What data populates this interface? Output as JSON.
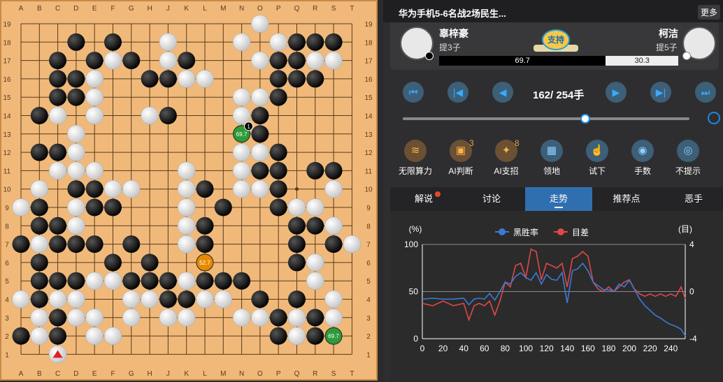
{
  "board": {
    "size": 19,
    "columns": [
      "A",
      "B",
      "C",
      "D",
      "E",
      "F",
      "G",
      "H",
      "J",
      "K",
      "L",
      "M",
      "N",
      "O",
      "P",
      "Q",
      "R",
      "S",
      "T"
    ],
    "rows": [
      "19",
      "18",
      "17",
      "16",
      "15",
      "14",
      "13",
      "12",
      "11",
      "10",
      "9",
      "8",
      "7",
      "6",
      "5",
      "4",
      "3",
      "2",
      "1"
    ],
    "black": [
      [
        3,
        18
      ],
      [
        5,
        18
      ],
      [
        15,
        18
      ],
      [
        16,
        18
      ],
      [
        17,
        18
      ],
      [
        2,
        17
      ],
      [
        4,
        17
      ],
      [
        6,
        17
      ],
      [
        9,
        17
      ],
      [
        14,
        17
      ],
      [
        15,
        17
      ],
      [
        2,
        16
      ],
      [
        3,
        16
      ],
      [
        7,
        16
      ],
      [
        8,
        16
      ],
      [
        14,
        16
      ],
      [
        15,
        16
      ],
      [
        16,
        16
      ],
      [
        2,
        15
      ],
      [
        3,
        15
      ],
      [
        14,
        15
      ],
      [
        1,
        14
      ],
      [
        8,
        14
      ],
      [
        13,
        14
      ],
      [
        13,
        13
      ],
      [
        1,
        12
      ],
      [
        2,
        12
      ],
      [
        14,
        12
      ],
      [
        13,
        11
      ],
      [
        14,
        11
      ],
      [
        16,
        11
      ],
      [
        17,
        11
      ],
      [
        3,
        10
      ],
      [
        4,
        10
      ],
      [
        10,
        10
      ],
      [
        14,
        10
      ],
      [
        1,
        9
      ],
      [
        4,
        9
      ],
      [
        5,
        9
      ],
      [
        11,
        9
      ],
      [
        14,
        9
      ],
      [
        1,
        8
      ],
      [
        2,
        8
      ],
      [
        10,
        8
      ],
      [
        15,
        8
      ],
      [
        16,
        8
      ],
      [
        0,
        7
      ],
      [
        2,
        7
      ],
      [
        3,
        7
      ],
      [
        4,
        7
      ],
      [
        6,
        7
      ],
      [
        10,
        7
      ],
      [
        15,
        7
      ],
      [
        17,
        7
      ],
      [
        1,
        6
      ],
      [
        5,
        6
      ],
      [
        7,
        6
      ],
      [
        15,
        6
      ],
      [
        16,
        6
      ],
      [
        1,
        5
      ],
      [
        2,
        5
      ],
      [
        3,
        5
      ],
      [
        6,
        5
      ],
      [
        7,
        5
      ],
      [
        8,
        5
      ],
      [
        10,
        5
      ],
      [
        11,
        5
      ],
      [
        12,
        5
      ],
      [
        1,
        4
      ],
      [
        8,
        4
      ],
      [
        9,
        4
      ],
      [
        13,
        4
      ],
      [
        15,
        4
      ],
      [
        2,
        3
      ],
      [
        14,
        3
      ],
      [
        16,
        3
      ],
      [
        0,
        2
      ],
      [
        2,
        2
      ],
      [
        14,
        2
      ],
      [
        16,
        2
      ]
    ],
    "white": [
      [
        13,
        19
      ],
      [
        8,
        18
      ],
      [
        12,
        18
      ],
      [
        14,
        18
      ],
      [
        5,
        17
      ],
      [
        8,
        17
      ],
      [
        13,
        17
      ],
      [
        16,
        17
      ],
      [
        17,
        17
      ],
      [
        4,
        16
      ],
      [
        9,
        16
      ],
      [
        10,
        16
      ],
      [
        4,
        15
      ],
      [
        12,
        15
      ],
      [
        13,
        15
      ],
      [
        2,
        14
      ],
      [
        4,
        14
      ],
      [
        7,
        14
      ],
      [
        12,
        14
      ],
      [
        3,
        13
      ],
      [
        3,
        12
      ],
      [
        12,
        12
      ],
      [
        13,
        12
      ],
      [
        2,
        11
      ],
      [
        3,
        11
      ],
      [
        4,
        11
      ],
      [
        9,
        11
      ],
      [
        12,
        11
      ],
      [
        1,
        10
      ],
      [
        5,
        10
      ],
      [
        6,
        10
      ],
      [
        9,
        10
      ],
      [
        12,
        10
      ],
      [
        13,
        10
      ],
      [
        17,
        10
      ],
      [
        0,
        9
      ],
      [
        3,
        9
      ],
      [
        9,
        9
      ],
      [
        15,
        9
      ],
      [
        16,
        9
      ],
      [
        3,
        8
      ],
      [
        9,
        8
      ],
      [
        17,
        8
      ],
      [
        1,
        7
      ],
      [
        9,
        7
      ],
      [
        18,
        7
      ],
      [
        16,
        6
      ],
      [
        4,
        5
      ],
      [
        5,
        5
      ],
      [
        9,
        5
      ],
      [
        16,
        5
      ],
      [
        0,
        4
      ],
      [
        2,
        4
      ],
      [
        3,
        4
      ],
      [
        6,
        4
      ],
      [
        7,
        4
      ],
      [
        10,
        4
      ],
      [
        11,
        4
      ],
      [
        17,
        4
      ],
      [
        1,
        3
      ],
      [
        3,
        3
      ],
      [
        4,
        3
      ],
      [
        6,
        3
      ],
      [
        8,
        3
      ],
      [
        9,
        3
      ],
      [
        12,
        3
      ],
      [
        13,
        3
      ],
      [
        15,
        3
      ],
      [
        17,
        3
      ],
      [
        1,
        2
      ],
      [
        4,
        2
      ],
      [
        5,
        2
      ],
      [
        15,
        2
      ]
    ],
    "hoshi": [
      [
        3,
        16
      ],
      [
        9,
        16
      ],
      [
        15,
        16
      ],
      [
        3,
        10
      ],
      [
        9,
        10
      ],
      [
        15,
        10
      ],
      [
        3,
        4
      ],
      [
        9,
        4
      ],
      [
        15,
        4
      ]
    ],
    "markers": [
      {
        "col": 12,
        "row": 13,
        "color": "#2e9a3a",
        "label": "69.7",
        "tag": "1"
      },
      {
        "col": 10,
        "row": 6,
        "color": "#e58a00",
        "label": "52.7",
        "tag": ""
      },
      {
        "col": 17,
        "row": 2,
        "color": "#2e9a3a",
        "label": "69.7",
        "tag": ""
      }
    ],
    "last_move": {
      "col": 2,
      "row": 1,
      "color": "#e02020"
    }
  },
  "header": {
    "title": "华为手机5-6名战2场民生...",
    "more_label": "更多"
  },
  "players": {
    "black_name": "辜梓豪",
    "black_captures": "提3子",
    "white_name": "柯洁",
    "white_captures": "提5子",
    "support_label": "支持",
    "black_winrate_label": "69.7",
    "white_winrate_label": "30.3",
    "black_winrate": 0.697
  },
  "navigation": {
    "move_counter": "162/ 254手",
    "current_move": 162,
    "total_moves": 254
  },
  "tools": [
    {
      "label": "无限算力",
      "icon": "wave-icon",
      "glyph": "≋",
      "count": ""
    },
    {
      "label": "AI判断",
      "icon": "ai-judge-icon",
      "glyph": "▣",
      "count": "3"
    },
    {
      "label": "AI支招",
      "icon": "bulb-icon",
      "glyph": "✦",
      "count": "8"
    },
    {
      "label": "领地",
      "icon": "calculator-icon",
      "glyph": "▦",
      "count": ""
    },
    {
      "label": "试下",
      "icon": "hand-pointer-icon",
      "glyph": "☝",
      "count": ""
    },
    {
      "label": "手数",
      "icon": "move-number-icon",
      "glyph": "◉",
      "count": ""
    },
    {
      "label": "不提示",
      "icon": "eye-icon",
      "glyph": "◎",
      "count": ""
    }
  ],
  "tabs": [
    {
      "label": "解说",
      "active": false,
      "dot": true
    },
    {
      "label": "讨论",
      "active": false,
      "dot": false
    },
    {
      "label": "走势",
      "active": true,
      "dot": false
    },
    {
      "label": "推荐点",
      "active": false,
      "dot": false
    },
    {
      "label": "恶手",
      "active": false,
      "dot": false
    }
  ],
  "chart_data": {
    "type": "line",
    "left_unit": "(%)",
    "right_unit": "(目)",
    "x_ticks": [
      "0",
      "20",
      "40",
      "60",
      "80",
      "100",
      "120",
      "140",
      "160",
      "180",
      "200",
      "220",
      "240"
    ],
    "y_left_ticks": [
      "0",
      "50",
      "100"
    ],
    "y_right_ticks": [
      "-4",
      "0",
      "4"
    ],
    "xlim": [
      0,
      254
    ],
    "ylim_left": [
      0,
      100
    ],
    "ylim_right": [
      -4,
      4
    ],
    "legend": [
      "黑胜率",
      "目差"
    ],
    "series": [
      {
        "name": "黑胜率",
        "color": "#3a7bd5",
        "axis": "left",
        "x": [
          0,
          10,
          20,
          30,
          40,
          45,
          50,
          55,
          60,
          65,
          70,
          75,
          80,
          85,
          90,
          95,
          100,
          105,
          110,
          115,
          120,
          125,
          130,
          135,
          140,
          145,
          150,
          155,
          160,
          165,
          170,
          175,
          180,
          185,
          190,
          195,
          200,
          205,
          210,
          215,
          220,
          225,
          230,
          235,
          240,
          245,
          250,
          254
        ],
        "y": [
          42,
          43,
          42,
          42,
          43,
          36,
          42,
          43,
          42,
          48,
          41,
          50,
          60,
          58,
          66,
          70,
          65,
          62,
          70,
          58,
          68,
          63,
          62,
          70,
          38,
          72,
          74,
          80,
          72,
          60,
          56,
          52,
          52,
          50,
          58,
          55,
          62,
          52,
          42,
          35,
          30,
          25,
          22,
          18,
          15,
          13,
          10,
          3
        ]
      },
      {
        "name": "目差",
        "color": "#e04848",
        "axis": "right",
        "x": [
          0,
          10,
          20,
          30,
          40,
          45,
          50,
          55,
          60,
          65,
          70,
          75,
          80,
          85,
          90,
          95,
          100,
          105,
          110,
          115,
          120,
          125,
          130,
          135,
          140,
          145,
          150,
          155,
          160,
          165,
          170,
          175,
          180,
          185,
          190,
          195,
          200,
          205,
          210,
          215,
          220,
          225,
          230,
          235,
          240,
          245,
          250,
          254
        ],
        "y": [
          -1.0,
          -1.2,
          -0.8,
          -1.2,
          -1.0,
          -2.4,
          -1.2,
          -1.0,
          -1.2,
          -0.8,
          -2.0,
          -0.8,
          0.8,
          0.4,
          2.2,
          2.4,
          1.2,
          3.6,
          3.4,
          1.0,
          2.4,
          2.2,
          2.0,
          2.4,
          0.4,
          2.8,
          3.0,
          3.4,
          3.0,
          0.8,
          0.2,
          0.0,
          0.4,
          0.0,
          0.4,
          0.8,
          1.0,
          0.2,
          -0.2,
          -0.4,
          -0.2,
          -0.4,
          -0.2,
          -0.4,
          -0.2,
          -0.4,
          0.4,
          -0.6
        ]
      }
    ]
  }
}
